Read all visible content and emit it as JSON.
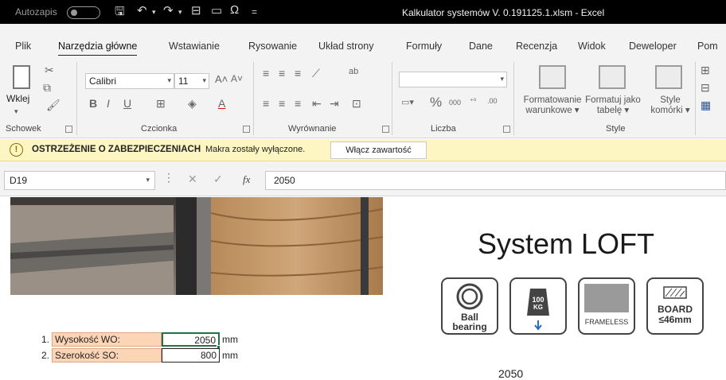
{
  "title_bar": {
    "autosave_label": "Autozapis",
    "document_title": "Kalkulator systemów V. 0.191125.1.xlsm  -  Excel"
  },
  "tabs": [
    "Plik",
    "Narzędzia główne",
    "Wstawianie",
    "Rysowanie",
    "Układ strony",
    "Formuły",
    "Dane",
    "Recenzja",
    "Widok",
    "Deweloper",
    "Pom"
  ],
  "active_tab": "Narzędzia główne",
  "ribbon": {
    "clipboard": {
      "paste_label": "Wklej",
      "group_label": "Schowek"
    },
    "font": {
      "font_name": "Calibri",
      "font_size": "11",
      "group_label": "Czcionka"
    },
    "alignment": {
      "group_label": "Wyrównanie"
    },
    "number": {
      "format_value": "",
      "group_label": "Liczba"
    },
    "styles": {
      "conditional_line1": "Formatowanie",
      "conditional_line2": "warunkowe",
      "table_line1": "Formatuj jako",
      "table_line2": "tabelę",
      "cell_line1": "Style",
      "cell_line2": "komórki",
      "group_label": "Style"
    }
  },
  "security_bar": {
    "title": "OSTRZEŻENIE O ZABEZPIECZENIACH",
    "message": "Makra zostały wyłączone.",
    "button": "Włącz zawartość"
  },
  "formula_bar": {
    "name_box": "D19",
    "formula": "2050"
  },
  "sheet": {
    "system_title": "System LOFT",
    "badges": [
      {
        "icon": "ball-bearing-icon",
        "line1": "Ball",
        "line2": "bearing"
      },
      {
        "icon": "weight-icon",
        "line1": "100",
        "line2": "KG"
      },
      {
        "icon": "frameless-icon",
        "line1": "FRAMELESS"
      },
      {
        "icon": "board-icon",
        "line1": "BOARD",
        "line2": "≤46mm"
      }
    ],
    "rows": [
      {
        "num": "1.",
        "label": "Wysokość WO:",
        "value": "2050",
        "unit": "mm"
      },
      {
        "num": "2.",
        "label": "Szerokość SO:",
        "value": "800",
        "unit": "mm"
      }
    ],
    "partial_text": "2050"
  },
  "colors": {
    "title_bar_bg": "#000000",
    "security_bar_bg": "#fdf6c3",
    "input_label_bg": "#fbd5b5",
    "selection": "#217346"
  }
}
